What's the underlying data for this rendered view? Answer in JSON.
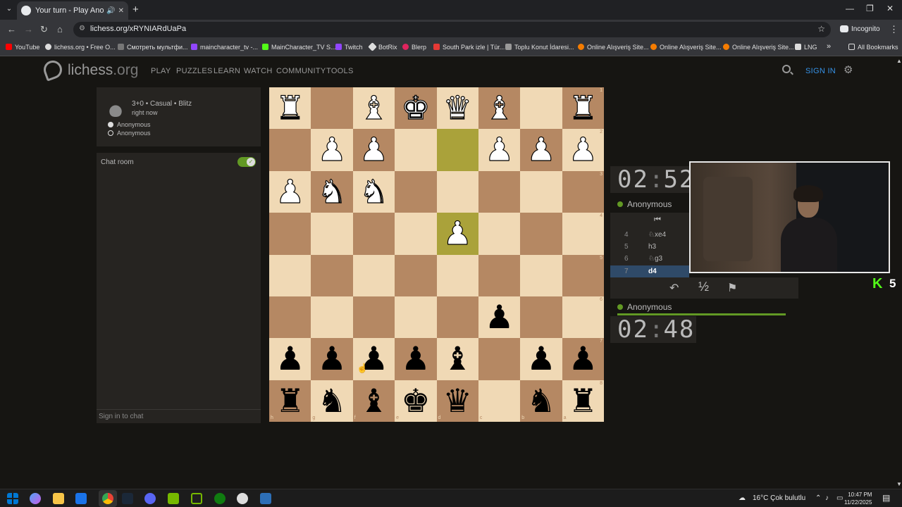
{
  "browser": {
    "tab_title": "Your turn - Play Anon. • lic",
    "url": "lichess.org/xRYNIARdUaPa",
    "mode_label": "Incognito",
    "bookmarks": [
      "YouTube",
      "lichess.org • Free O...",
      "Смотреть мультфи...",
      "maincharacter_tv -...",
      "MainCharacter_TV S...",
      "Twitch",
      "BotRix",
      "Blerp",
      "South Park izle | Tür...",
      "Toplu Konut İdaresi...",
      "Online Alışveriş Site...",
      "Online Alışveriş Site...",
      "Online Alışveriş Site...",
      "LNG"
    ],
    "all_bookmarks": "All Bookmarks",
    "more_bookmarks": "»"
  },
  "site": {
    "logo": "lichess",
    "logo_tld": ".org",
    "nav": [
      "PLAY",
      "PUZZLES",
      "LEARN",
      "WATCH",
      "COMMUNITY",
      "TOOLS"
    ],
    "signin": "SIGN IN"
  },
  "game": {
    "title": "3+0 • Casual • Blitz",
    "time": "right now",
    "players": [
      "Anonymous",
      "Anonymous"
    ]
  },
  "chat": {
    "title": "Chat room",
    "enabled": true,
    "footer": "Sign in to chat"
  },
  "board": {
    "orientation": "black",
    "rows": [
      [
        "wR",
        "",
        "wB",
        "wK",
        "wQ",
        "wB",
        "",
        "wR"
      ],
      [
        "",
        "wP",
        "wP",
        "",
        "",
        "wP",
        "wP",
        "wP"
      ],
      [
        "wP",
        "wN",
        "wN",
        "",
        "",
        "",
        "",
        ""
      ],
      [
        "",
        "",
        "",
        "",
        "wP",
        "",
        "",
        ""
      ],
      [
        "",
        "",
        "",
        "",
        "",
        "",
        "",
        ""
      ],
      [
        "",
        "",
        "",
        "",
        "",
        "bP",
        "",
        ""
      ],
      [
        "bP",
        "bP",
        "bP",
        "bP",
        "bB",
        "",
        "bP",
        "bP"
      ],
      [
        "bR",
        "bN",
        "bB",
        "bK",
        "bQ",
        "",
        "bN",
        "bR"
      ]
    ],
    "highlights": [
      [
        1,
        4
      ],
      [
        3,
        4
      ]
    ],
    "rank_labels": [
      "1",
      "2",
      "3",
      "4",
      "5",
      "6",
      "7",
      "8"
    ],
    "file_labels": [
      "h",
      "g",
      "f",
      "e",
      "d",
      "c",
      "b",
      "a"
    ]
  },
  "opponent": {
    "clock_min": "02",
    "clock_sep": ":",
    "clock_sec": "52",
    "name": "Anonymous"
  },
  "me": {
    "clock_min": "02",
    "clock_sep": ":",
    "clock_sec": "48",
    "name": "Anonymous"
  },
  "moves": [
    {
      "n": "4",
      "san": "♘xe4"
    },
    {
      "n": "5",
      "san": "h3"
    },
    {
      "n": "6",
      "san": "♘g3"
    },
    {
      "n": "7",
      "san": "d4",
      "current": true
    }
  ],
  "controls": {
    "takeback": "↶",
    "draw": "½",
    "resign": "⚑",
    "first": "⏮"
  },
  "overlay": {
    "kick_logo": "K",
    "kick_count": "5"
  },
  "taskbar": {
    "weather": "16°C  Çok bulutlu",
    "time": "10:47 PM",
    "date": "11/22/2025"
  }
}
